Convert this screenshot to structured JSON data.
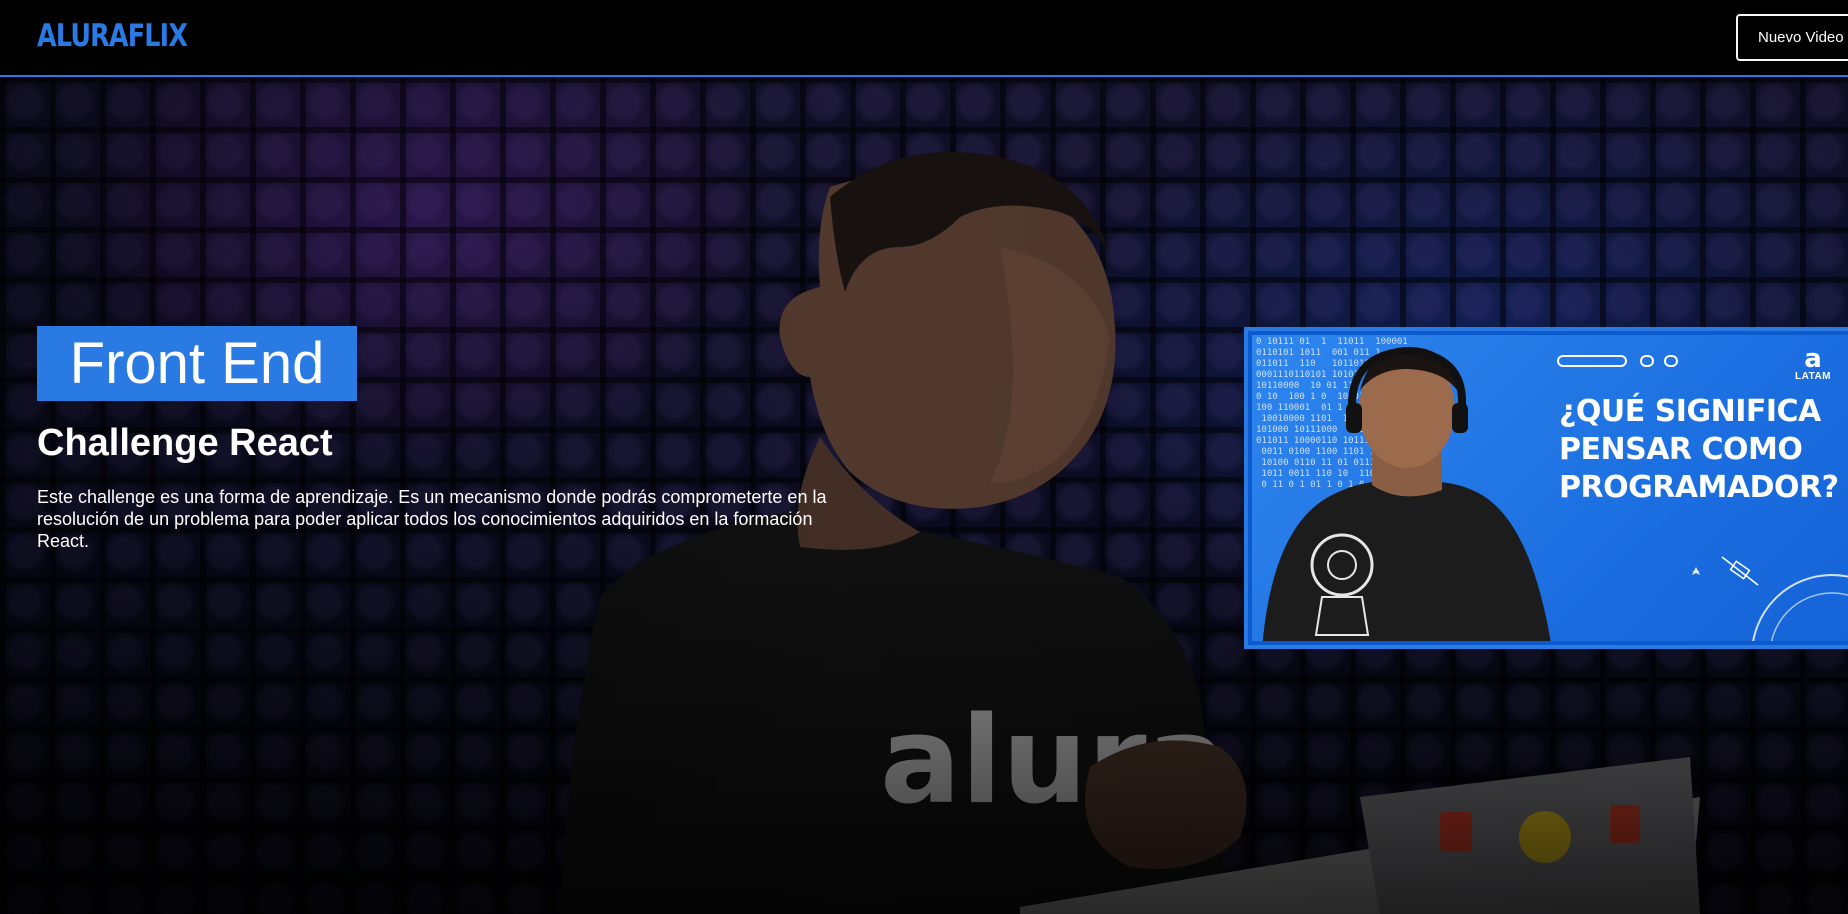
{
  "header": {
    "logo": "ALURAFLIX",
    "new_video_label": "Nuevo Video"
  },
  "banner": {
    "category": "Front End",
    "title": "Challenge React",
    "description": "Este challenge es una forma de aprendizaje. Es un mecanismo donde podrás comprometerte en la resolución de un problema para poder aplicar todos los conocimientos adquiridos en la formación React.",
    "presenter_shirt_text": "alura"
  },
  "video_card": {
    "headline_line1": "¿QUÉ SIGNIFICA",
    "headline_line2": "PENSAR COMO",
    "headline_line3": "PROGRAMADOR?",
    "brand": "LATAM",
    "binary_text": "0 10111 01  1  11011  100001\n0110101 1011  001 011 1\n011011  110   10110110  1\n0001110110101 101010 10001\n10110000  10 01 110   0\n0 10  100 1 0  10 01  1\n100 110001  01 1 1101001 1\n 10010000 1101  10110 0001\n101000 10111000  11011 110\n011011 10000110 10111111101\n 0011 0100 1100 1101 10110\n 10100 0110 11 01 0111 0\n 1011 0011 110 10  1101\n 0 11 0 1 01 1 0 1 0"
  },
  "colors": {
    "accent": "#2a7ae4",
    "header_bg": "#000000",
    "text": "#ffffff"
  }
}
